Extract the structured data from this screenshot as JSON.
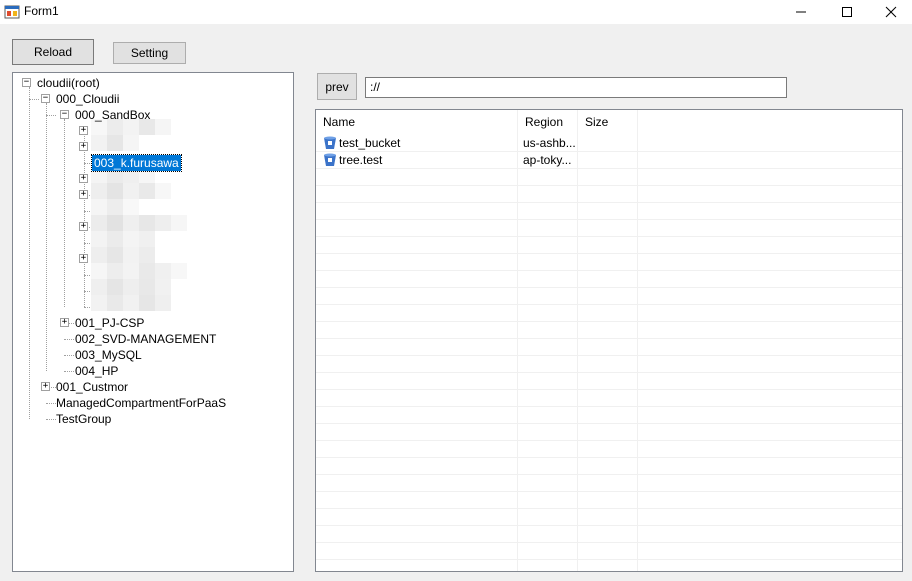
{
  "window": {
    "title": "Form1",
    "icon": "form-app-icon"
  },
  "toolbar": {
    "reload_label": "Reload",
    "setting_label": "Setting"
  },
  "nav": {
    "prev_label": "prev",
    "path_value": "://"
  },
  "tree": {
    "root": "cloudii(root)",
    "n_cloudii": "000_Cloudii",
    "n_sandbox": "000_SandBox",
    "n_selected": "003_k.furusawa",
    "n_pjcsp": "001_PJ-CSP",
    "n_svd": "002_SVD-MANAGEMENT",
    "n_mysql": "003_MySQL",
    "n_hp": "004_HP",
    "n_custmor": "001_Custmor",
    "n_managed": "ManagedCompartmentForPaaS",
    "n_testgroup": "TestGroup"
  },
  "list": {
    "columns": [
      "Name",
      "Region",
      "Size"
    ],
    "rows": [
      {
        "name": "test_bucket",
        "region": "us-ashb...",
        "size": "",
        "icon": "bucket-icon"
      },
      {
        "name": "tree.test",
        "region": "ap-toky...",
        "size": "",
        "icon": "bucket-icon"
      }
    ]
  }
}
